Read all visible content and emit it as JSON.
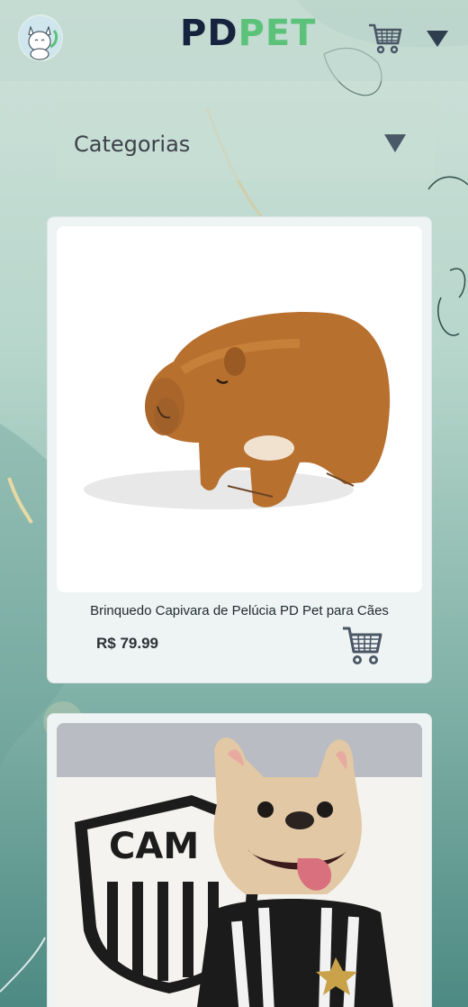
{
  "header": {
    "brand_pd": "PD",
    "brand_pet": "PET",
    "logo_icon": "cat-avatar-icon",
    "cart_icon": "shopping-cart-icon",
    "menu_icon": "caret-down-icon"
  },
  "categories": {
    "label": "Categorias",
    "toggle_icon": "caret-down-icon"
  },
  "products": [
    {
      "title": "Brinquedo Capivara de Pelúcia PD Pet para Cães",
      "price": "R$ 79.99",
      "image": "capybara-plush-image",
      "cart_icon": "add-to-cart-icon"
    },
    {
      "title": "",
      "price": "",
      "image": "french-bulldog-jersey-image",
      "crest_text": "CAM",
      "cart_icon": "add-to-cart-icon"
    }
  ],
  "colors": {
    "brand_dark": "#16233f",
    "brand_green": "#5cc27a",
    "icon_slate": "#4a5565"
  }
}
